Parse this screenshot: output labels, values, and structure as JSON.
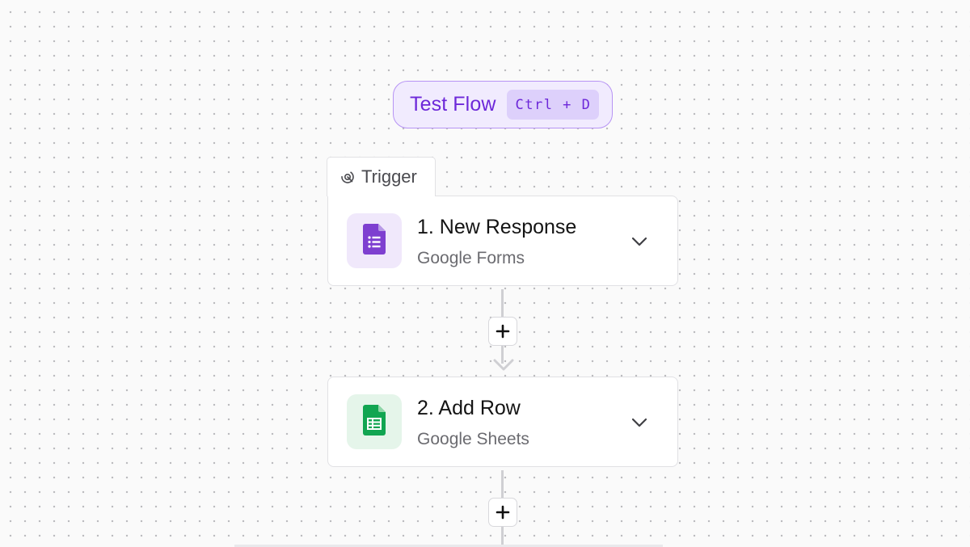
{
  "test_flow": {
    "label": "Test Flow",
    "shortcut": "Ctrl + D"
  },
  "trigger_tab": {
    "label": "Trigger",
    "icon": "trigger-icon"
  },
  "steps": [
    {
      "title": "1. New Response",
      "app": "Google Forms",
      "icon": "google-forms-icon",
      "accent": "#7e3fd0"
    },
    {
      "title": "2. Add Row",
      "app": "Google Sheets",
      "icon": "google-sheets-icon",
      "accent": "#11a551"
    }
  ],
  "colors": {
    "accent": "#6d28d9",
    "accent_bg": "#f1ebfe",
    "accent_border": "#b794f4"
  }
}
